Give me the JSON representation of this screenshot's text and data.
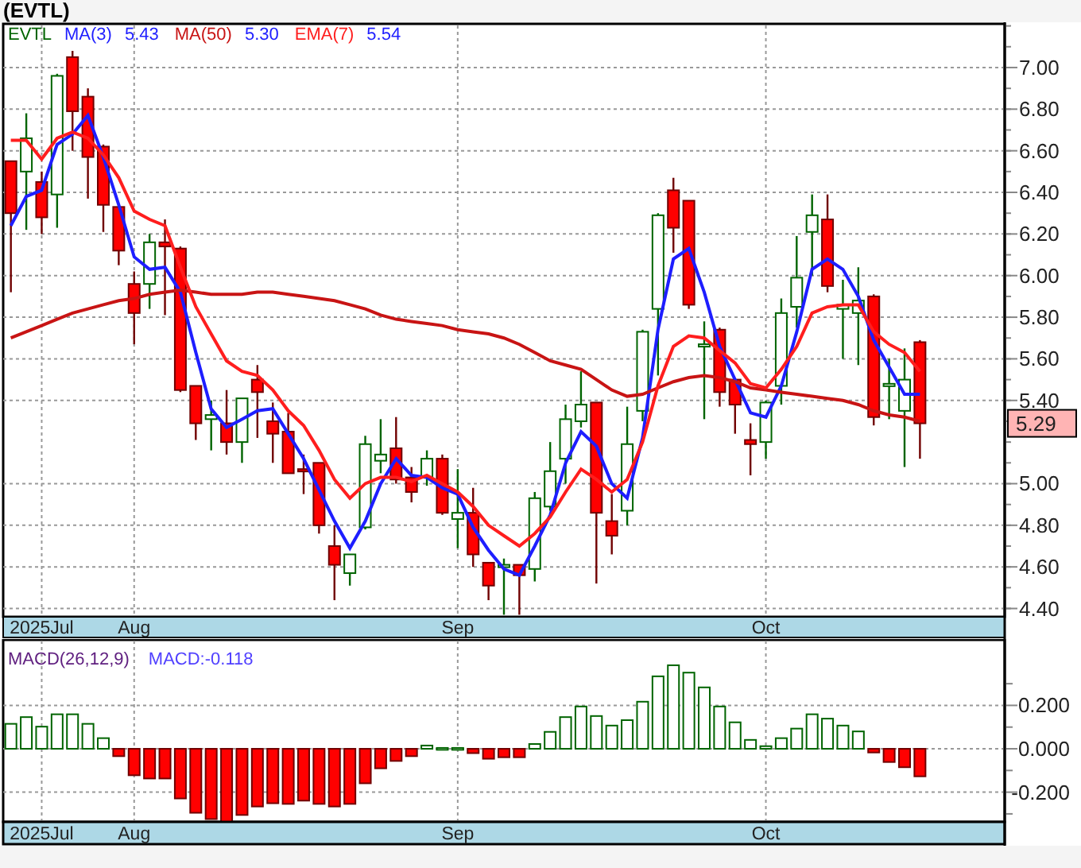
{
  "title": "(EVTL)",
  "price_chart": {
    "legend": {
      "symbol": "EVTL",
      "values": [
        "5.43",
        "5.30",
        "5.54"
      ]
    },
    "last_price": "5.29",
    "chart_data": {
      "type": "candlestick",
      "ylim": [
        4.36,
        7.21
      ],
      "grid": true,
      "categories": [
        null,
        null,
        "2025Jul",
        null,
        null,
        null,
        null,
        null,
        "Aug",
        null,
        null,
        null,
        null,
        null,
        null,
        null,
        null,
        null,
        null,
        null,
        null,
        null,
        null,
        null,
        null,
        null,
        null,
        null,
        null,
        "Sep",
        null,
        null,
        null,
        null,
        null,
        null,
        null,
        null,
        null,
        null,
        null,
        null,
        null,
        null,
        null,
        null,
        null,
        null,
        null,
        "Oct",
        null,
        null,
        null,
        null,
        null,
        null,
        null,
        null,
        null,
        null,
        null,
        null,
        null,
        null,
        null
      ],
      "yticks": [
        {
          "value": 7.0,
          "label": "7.00"
        },
        {
          "value": 6.8,
          "label": "6.80"
        },
        {
          "value": 6.6,
          "label": "6.60"
        },
        {
          "value": 6.4,
          "label": "6.40"
        },
        {
          "value": 6.2,
          "label": "6.20"
        },
        {
          "value": 6.0,
          "label": "6.00"
        },
        {
          "value": 5.8,
          "label": "5.80"
        },
        {
          "value": 5.6,
          "label": "5.60"
        },
        {
          "value": 5.4,
          "label": "5.40"
        },
        {
          "value": 5.0,
          "label": "5.00"
        },
        {
          "value": 4.8,
          "label": "4.80"
        },
        {
          "value": 4.6,
          "label": "4.60"
        },
        {
          "value": 4.4,
          "label": "4.40"
        }
      ],
      "ohlc": [
        [
          6.55,
          6.55,
          5.92,
          6.3
        ],
        [
          6.5,
          6.78,
          6.22,
          6.66
        ],
        [
          6.45,
          6.5,
          6.2,
          6.28
        ],
        [
          6.39,
          6.97,
          6.23,
          6.96
        ],
        [
          7.05,
          7.08,
          6.6,
          6.79
        ],
        [
          6.86,
          6.9,
          6.37,
          6.57
        ],
        [
          6.62,
          6.63,
          6.21,
          6.34
        ],
        [
          6.33,
          6.33,
          6.05,
          6.12
        ],
        [
          5.96,
          6.02,
          5.67,
          5.82
        ],
        [
          5.96,
          6.2,
          5.84,
          6.16
        ],
        [
          6.16,
          6.27,
          5.81,
          6.14
        ],
        [
          6.13,
          6.14,
          5.44,
          5.45
        ],
        [
          5.47,
          5.47,
          5.21,
          5.29
        ],
        [
          5.31,
          5.4,
          5.16,
          5.33
        ],
        [
          5.29,
          5.45,
          5.14,
          5.2
        ],
        [
          5.2,
          5.41,
          5.1,
          5.41
        ],
        [
          5.5,
          5.57,
          5.22,
          5.44
        ],
        [
          5.3,
          5.39,
          5.1,
          5.24
        ],
        [
          5.25,
          5.34,
          5.05,
          5.05
        ],
        [
          5.07,
          5.14,
          4.95,
          5.06
        ],
        [
          5.1,
          5.1,
          4.76,
          4.8
        ],
        [
          4.7,
          4.8,
          4.44,
          4.61
        ],
        [
          4.57,
          4.66,
          4.51,
          4.66
        ],
        [
          4.79,
          5.23,
          4.78,
          5.19
        ],
        [
          5.11,
          5.31,
          5.05,
          5.14
        ],
        [
          5.17,
          5.32,
          5.0,
          5.02
        ],
        [
          5.03,
          5.08,
          4.91,
          4.96
        ],
        [
          5.03,
          5.16,
          4.99,
          5.12
        ],
        [
          5.12,
          5.14,
          4.85,
          4.86
        ],
        [
          4.83,
          5.07,
          4.69,
          4.86
        ],
        [
          4.86,
          4.98,
          4.6,
          4.66
        ],
        [
          4.62,
          4.62,
          4.44,
          4.51
        ],
        [
          4.6,
          4.64,
          4.37,
          4.61
        ],
        [
          4.61,
          4.61,
          4.37,
          4.56
        ],
        [
          4.59,
          4.96,
          4.53,
          4.93
        ],
        [
          4.89,
          5.2,
          4.87,
          5.06
        ],
        [
          5.12,
          5.38,
          5.0,
          5.31
        ],
        [
          5.3,
          5.54,
          5.27,
          5.38
        ],
        [
          5.39,
          5.39,
          4.52,
          4.86
        ],
        [
          4.82,
          4.95,
          4.66,
          4.75
        ],
        [
          4.87,
          5.37,
          4.8,
          5.19
        ],
        [
          5.35,
          5.74,
          5.3,
          5.73
        ],
        [
          5.84,
          6.3,
          5.52,
          6.29
        ],
        [
          6.41,
          6.47,
          6.11,
          6.23
        ],
        [
          6.36,
          6.36,
          5.84,
          5.86
        ],
        [
          5.66,
          5.78,
          5.31,
          5.67
        ],
        [
          5.74,
          5.75,
          5.37,
          5.44
        ],
        [
          5.5,
          5.5,
          5.24,
          5.38
        ],
        [
          5.21,
          5.29,
          5.04,
          5.19
        ],
        [
          5.2,
          5.4,
          5.12,
          5.39
        ],
        [
          5.47,
          5.89,
          5.38,
          5.82
        ],
        [
          5.85,
          6.19,
          5.75,
          5.99
        ],
        [
          6.21,
          6.39,
          6.0,
          6.29
        ],
        [
          6.27,
          6.39,
          5.92,
          5.95
        ],
        [
          5.84,
          5.98,
          5.6,
          5.86
        ],
        [
          5.82,
          6.04,
          5.57,
          5.88
        ],
        [
          5.9,
          5.91,
          5.28,
          5.32
        ],
        [
          5.47,
          5.6,
          5.31,
          5.48
        ],
        [
          5.35,
          5.65,
          5.08,
          5.5
        ],
        [
          5.68,
          5.69,
          5.12,
          5.29
        ],
        null,
        null,
        null,
        null,
        null
      ],
      "series": [
        {
          "name": "MA(3)",
          "type": "line",
          "color": "#1e1eff",
          "values": [
            6.24,
            6.38,
            6.41,
            6.63,
            6.68,
            6.77,
            6.57,
            6.34,
            6.09,
            6.03,
            6.04,
            5.92,
            5.63,
            5.36,
            5.27,
            5.31,
            5.35,
            5.36,
            5.24,
            5.12,
            4.97,
            4.82,
            4.69,
            4.82,
            5.0,
            5.12,
            5.04,
            5.03,
            4.98,
            4.95,
            4.79,
            4.68,
            4.59,
            4.56,
            4.7,
            4.85,
            5.1,
            5.25,
            5.18,
            5.0,
            4.93,
            5.22,
            5.74,
            6.08,
            6.13,
            5.92,
            5.66,
            5.5,
            5.34,
            5.32,
            5.47,
            5.73,
            6.03,
            6.08,
            6.03,
            5.9,
            5.69,
            5.56,
            5.43,
            5.43,
            null,
            null,
            null,
            null,
            null
          ]
        },
        {
          "name": "MA(50)",
          "type": "line",
          "color": "#c81414",
          "values": [
            5.7,
            5.73,
            5.76,
            5.79,
            5.82,
            5.84,
            5.86,
            5.88,
            5.89,
            5.91,
            5.92,
            5.93,
            5.92,
            5.91,
            5.91,
            5.91,
            5.92,
            5.92,
            5.91,
            5.9,
            5.89,
            5.88,
            5.86,
            5.84,
            5.81,
            5.79,
            5.78,
            5.77,
            5.76,
            5.74,
            5.73,
            5.72,
            5.7,
            5.67,
            5.63,
            5.59,
            5.57,
            5.55,
            5.5,
            5.45,
            5.42,
            5.43,
            5.46,
            5.49,
            5.51,
            5.52,
            5.51,
            5.49,
            5.46,
            5.45,
            5.44,
            5.43,
            5.42,
            5.41,
            5.4,
            5.38,
            5.35,
            5.33,
            5.32,
            5.3,
            null,
            null,
            null,
            null,
            null
          ]
        },
        {
          "name": "EMA(7)",
          "type": "line",
          "color": "#ff1e1e",
          "values": [
            6.65,
            6.65,
            6.56,
            6.66,
            6.69,
            6.66,
            6.58,
            6.47,
            6.31,
            6.27,
            6.24,
            6.04,
            5.85,
            5.72,
            5.59,
            5.54,
            5.52,
            5.45,
            5.35,
            5.28,
            5.16,
            5.02,
            4.93,
            5.0,
            5.03,
            5.03,
            5.01,
            5.04,
            5.0,
            4.96,
            4.89,
            4.8,
            4.75,
            4.7,
            4.76,
            4.84,
            4.96,
            5.07,
            5.02,
            4.96,
            5.02,
            5.2,
            5.47,
            5.66,
            5.71,
            5.7,
            5.64,
            5.58,
            5.48,
            5.46,
            5.55,
            5.66,
            5.82,
            5.85,
            5.86,
            5.86,
            5.73,
            5.67,
            5.63,
            5.54,
            null,
            null,
            null,
            null,
            null
          ]
        }
      ]
    }
  },
  "macd_chart": {
    "legend": {
      "name": "MACD(26,12,9)",
      "value": "MACD:-0.118"
    },
    "chart_data": {
      "type": "bar",
      "ylim": [
        -0.337,
        0.502
      ],
      "grid": true,
      "categories": [
        null,
        null,
        "2025Jul",
        null,
        null,
        null,
        null,
        null,
        "Aug",
        null,
        null,
        null,
        null,
        null,
        null,
        null,
        null,
        null,
        null,
        null,
        null,
        null,
        null,
        null,
        null,
        null,
        null,
        null,
        null,
        "Sep",
        null,
        null,
        null,
        null,
        null,
        null,
        null,
        null,
        null,
        null,
        null,
        null,
        null,
        null,
        null,
        null,
        null,
        null,
        null,
        "Oct",
        null,
        null,
        null,
        null,
        null,
        null,
        null,
        null,
        null,
        null,
        null,
        null,
        null,
        null,
        null
      ],
      "yticks": [
        {
          "value": 0.2,
          "label": "0.200"
        },
        {
          "value": 0,
          "label": "0.000"
        },
        {
          "value": -0.2,
          "label": "-0.200"
        }
      ],
      "values": [
        0.115,
        0.146,
        0.102,
        0.159,
        0.159,
        0.115,
        0.049,
        -0.034,
        -0.122,
        -0.137,
        -0.137,
        -0.229,
        -0.295,
        -0.324,
        -0.337,
        -0.305,
        -0.266,
        -0.251,
        -0.254,
        -0.239,
        -0.254,
        -0.266,
        -0.254,
        -0.159,
        -0.09,
        -0.056,
        -0.034,
        0.015,
        0.004,
        0.004,
        -0.02,
        -0.046,
        -0.039,
        -0.039,
        0.022,
        0.078,
        0.146,
        0.195,
        0.151,
        0.107,
        0.132,
        0.217,
        0.334,
        0.385,
        0.351,
        0.283,
        0.195,
        0.122,
        0.041,
        0.012,
        0.049,
        0.093,
        0.159,
        0.139,
        0.107,
        0.08,
        -0.017,
        -0.061,
        -0.085,
        -0.127,
        null,
        null,
        null,
        null,
        null
      ]
    }
  }
}
